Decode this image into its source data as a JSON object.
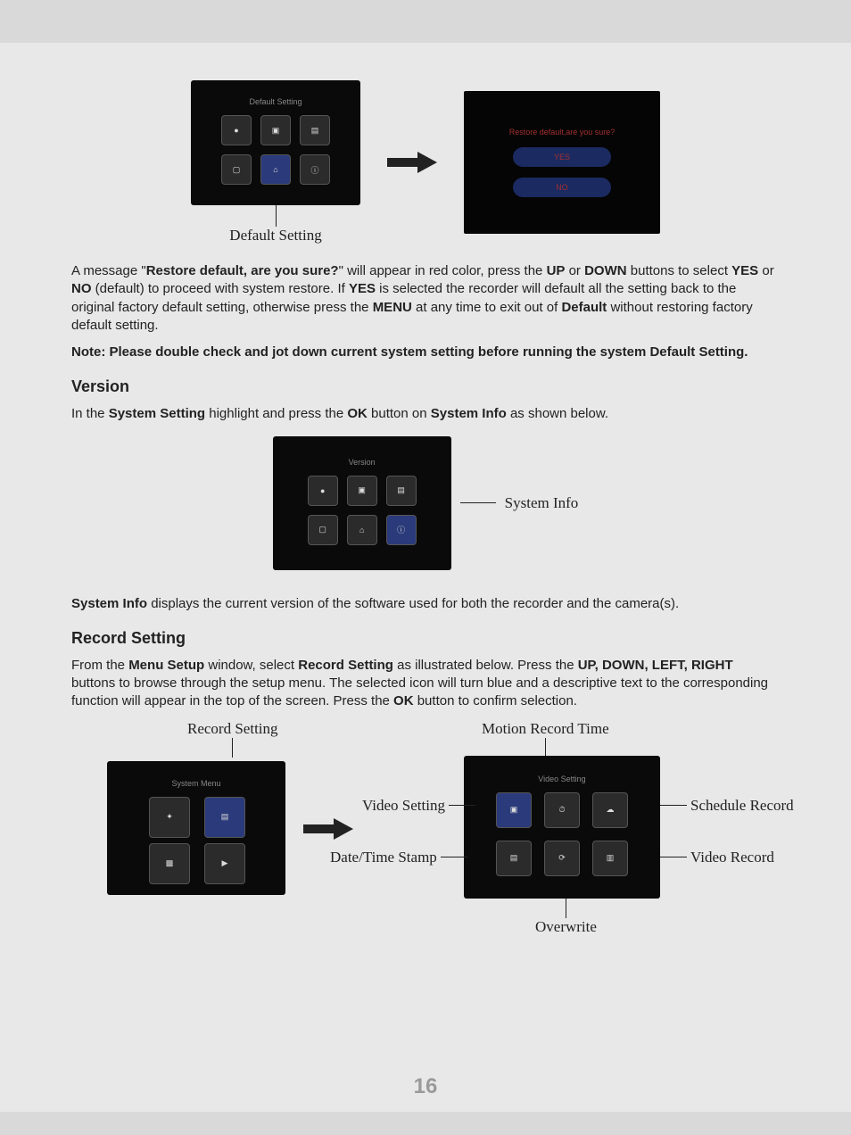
{
  "figures": {
    "default_setting_title": "Default Setting",
    "confirm": {
      "prompt": "Restore default,are you sure?",
      "yes": "YES",
      "no": "NO"
    },
    "default_caption": "Default Setting",
    "version_title": "Version",
    "system_info_callout": "System Info",
    "system_menu_title": "System Menu",
    "video_setting_title": "Video Setting"
  },
  "para1": {
    "t1": "A message \"",
    "b1": "Restore default, are you sure?",
    "t2": "\" will appear in red color, press the ",
    "b2": "UP",
    "t3": " or ",
    "b3": "DOWN",
    "t4": " buttons to select ",
    "b4": "YES",
    "t5": " or ",
    "b5": "NO",
    "t6": " (default) to proceed with system restore.  If ",
    "b6": "YES",
    "t7": " is selected the recorder will default all the setting back to the original factory default setting, otherwise press the ",
    "b7": "MENU",
    "t8": " at any time to exit out of ",
    "b8": "Default",
    "t9": " without restoring factory default setting."
  },
  "note": "Note: Please double check and jot down current system setting before running the system Default Setting.",
  "version_heading": "Version",
  "version_line": {
    "t1": "In the ",
    "b1": "System Setting",
    "t2": " highlight and press the ",
    "b2": "OK",
    "t3": " button on ",
    "b3": "System Info",
    "t4": " as shown below."
  },
  "system_info_line": {
    "b1": "System Info",
    "t1": " displays the current version of the software used for both the recorder and the camera(s)."
  },
  "record_heading": "Record Setting",
  "record_para": {
    "t1": "From the ",
    "b1": "Menu Setup",
    "t2": " window, select ",
    "b2": "Record Setting",
    "t3": " as illustrated below.  Press the ",
    "b3": "UP, DOWN, LEFT, RIGHT",
    "t4": " buttons to browse through the setup menu.  The selected icon will turn blue and a descriptive text to the corresponding function will appear in the top of the screen.  Press the ",
    "b4": "OK",
    "t5": " button to confirm selection."
  },
  "callouts": {
    "record_setting": "Record Setting",
    "motion_record_time": "Motion Record Time",
    "video_setting": "Video Setting",
    "schedule_record": "Schedule Record",
    "date_time_stamp": "Date/Time Stamp",
    "video_record": "Video Record",
    "overwrite": "Overwrite"
  },
  "page_number": "16"
}
